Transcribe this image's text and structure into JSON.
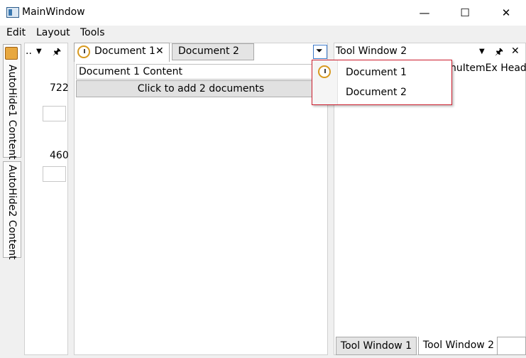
{
  "window": {
    "title": "MainWindow",
    "minimize": "—",
    "maximize": "☐",
    "close": "✕"
  },
  "menu": [
    "Edit",
    "Layout",
    "Tools"
  ],
  "autohide": {
    "tab1": "AutoHide1 Content",
    "tab2": "AutoHide2 Content"
  },
  "left_pane": {
    "header_ellipsis": "..",
    "menu_glyph": "▼",
    "pin_glyph": "🖈",
    "value1": "722",
    "value2": "460"
  },
  "documents": {
    "tab1": "Document 1",
    "tab1_close": "✕",
    "tab2": "Document 2",
    "content": "Document 1 Content",
    "add_button": "Click to add 2 documents",
    "dropdown_glyph": "⏷"
  },
  "dropdown_menu": {
    "item1": "Document 1",
    "item2": "Document 2"
  },
  "tool_window": {
    "title": "Tool Window 2",
    "menu_glyph": "▼",
    "pin_glyph": "🖈",
    "close_glyph": "✕",
    "partial_text": "nuItemEx Heade",
    "tab1": "Tool Window 1",
    "tab2": "Tool Window 2"
  }
}
